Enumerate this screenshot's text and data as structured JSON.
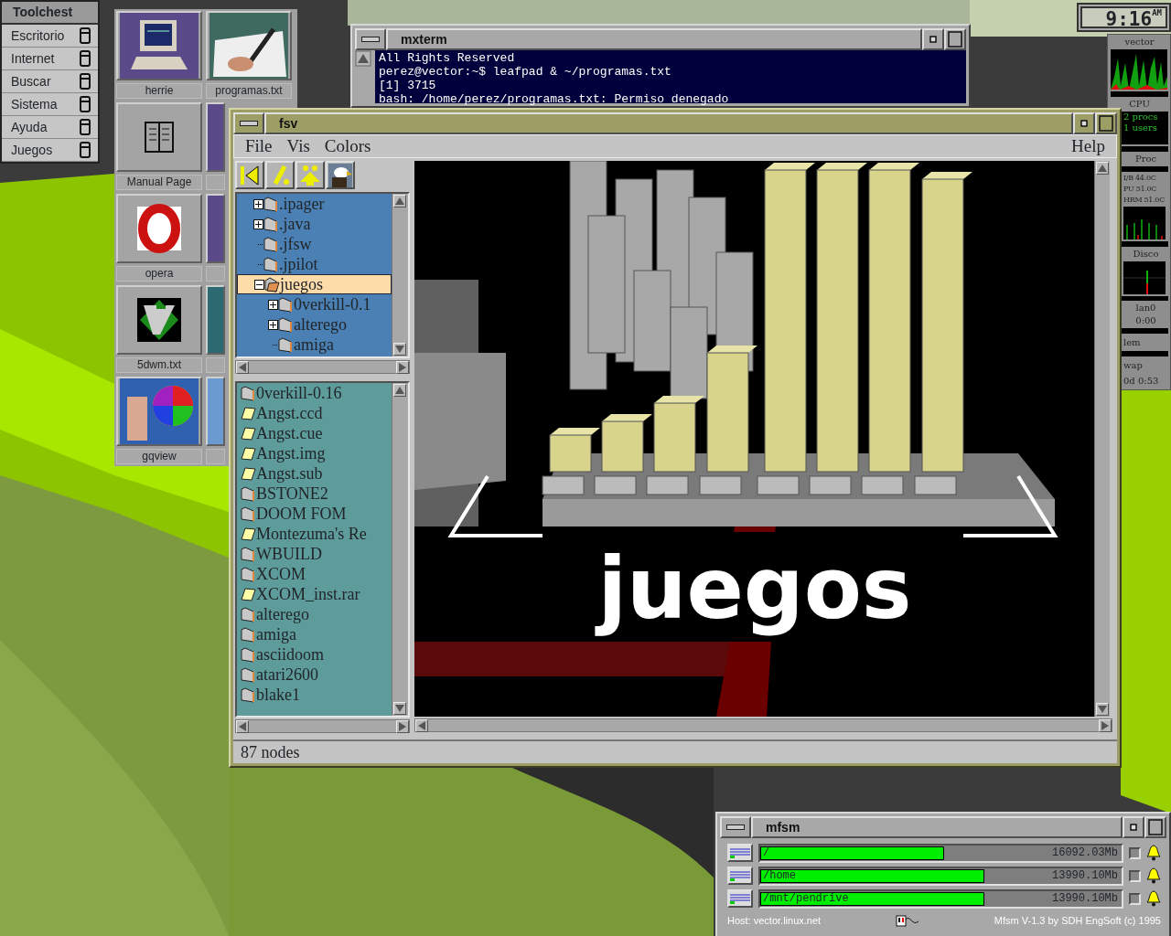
{
  "toolchest": {
    "title": "Toolchest",
    "items": [
      {
        "label": "Escritorio"
      },
      {
        "label": "Internet"
      },
      {
        "label": "Buscar"
      },
      {
        "label": "Sistema"
      },
      {
        "label": "Ayuda"
      },
      {
        "label": "Juegos"
      }
    ]
  },
  "desktop_icons": [
    {
      "label": "herrie",
      "kind": "computer"
    },
    {
      "label": "programas.txt",
      "kind": "pen"
    },
    {
      "label": "Manual Page",
      "kind": "book"
    },
    {
      "label": "opera",
      "kind": "opera"
    },
    {
      "label": "5dwm.txt",
      "kind": "vim"
    },
    {
      "label": "gqview",
      "kind": "palette"
    }
  ],
  "mxterm": {
    "title": "mxterm",
    "lines": [
      "All Rights Reserved",
      "perez@vector:~$ leafpad & ~/programas.txt",
      "[1] 3715",
      "bash: /home/perez/programas.txt: Permiso denegado"
    ]
  },
  "fsv": {
    "title": "fsv",
    "menus": [
      {
        "label": "File"
      },
      {
        "label": "Vis"
      },
      {
        "label": "Colors"
      }
    ],
    "help_menu": "Help",
    "tree": [
      {
        "label": ".ipager",
        "expandable": true,
        "expanded": false,
        "selected": false
      },
      {
        "label": ".java",
        "expandable": true,
        "expanded": false,
        "selected": false
      },
      {
        "label": ".jfsw",
        "expandable": false,
        "expanded": false,
        "selected": false
      },
      {
        "label": ".jpilot",
        "expandable": false,
        "expanded": false,
        "selected": false
      },
      {
        "label": "juegos",
        "expandable": true,
        "expanded": true,
        "selected": true,
        "children": [
          {
            "label": "0verkill-0.1",
            "expandable": true,
            "expanded": false,
            "selected": false
          },
          {
            "label": "alterego",
            "expandable": true,
            "expanded": false,
            "selected": false
          },
          {
            "label": "amiga",
            "expandable": false,
            "expanded": false,
            "selected": false
          }
        ]
      }
    ],
    "files": [
      {
        "label": "0verkill-0.16",
        "kind": "folder"
      },
      {
        "label": "Angst.ccd",
        "kind": "file"
      },
      {
        "label": "Angst.cue",
        "kind": "file"
      },
      {
        "label": "Angst.img",
        "kind": "file"
      },
      {
        "label": "Angst.sub",
        "kind": "file"
      },
      {
        "label": "BSTONE2",
        "kind": "folder"
      },
      {
        "label": "DOOM FOM",
        "kind": "folder"
      },
      {
        "label": "Montezuma's Re",
        "kind": "file"
      },
      {
        "label": "WBUILD",
        "kind": "folder"
      },
      {
        "label": "XCOM",
        "kind": "folder"
      },
      {
        "label": "XCOM_inst.rar",
        "kind": "file"
      },
      {
        "label": "alterego",
        "kind": "folder"
      },
      {
        "label": "amiga",
        "kind": "folder"
      },
      {
        "label": "asciidoom",
        "kind": "folder"
      },
      {
        "label": "atari2600",
        "kind": "folder"
      },
      {
        "label": "blake1",
        "kind": "folder"
      }
    ],
    "scene_label": "juegos",
    "status": "87 nodes"
  },
  "clock": {
    "time": "9:16",
    "period": "AM"
  },
  "monitor": {
    "host": "vector",
    "cpu": "CPU",
    "procs": "2 procs",
    "users": "1 users",
    "proc": "Proc",
    "temps": [
      "I/B 44.0C",
      "PU 51.0C",
      "HRM 51.0C"
    ],
    "disk": "Disco",
    "net": "lan0",
    "net_time": "0:00",
    "mem": "lem",
    "swap": "wap",
    "uptime": "0d 0:53"
  },
  "mfsm": {
    "title": "mfsm",
    "rows": [
      {
        "path": "/",
        "size": "16092.03Mb",
        "level": 0.51,
        "checked": false
      },
      {
        "path": "/home",
        "size": "13990.10Mb",
        "level": 0.62,
        "checked": false
      },
      {
        "path": "/mnt/pendrive",
        "size": "13990.10Mb",
        "level": 0.62,
        "checked": false
      }
    ],
    "host": "Host: vector.linux.net",
    "credit": "Mfsm V-1.3 by SDH EngSoft (c) 1995"
  }
}
